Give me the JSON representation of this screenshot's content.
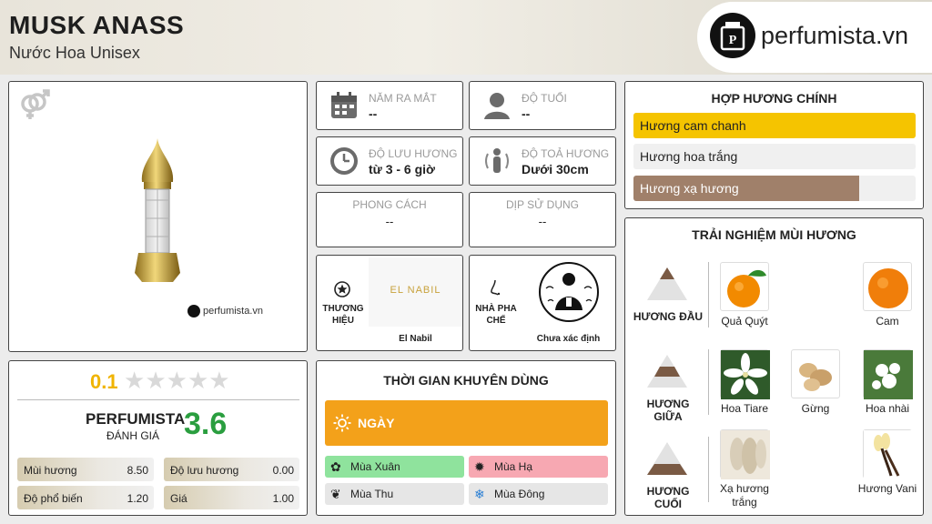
{
  "header": {
    "title": "MUSK ANASS",
    "subtitle": "Nước Hoa Unisex",
    "brand": "perfumista.vn"
  },
  "product": {
    "gender_icon": "gender-unisex-icon",
    "watermark": "perfumista.vn"
  },
  "info": {
    "release_label": "NĂM RA MẮT",
    "release_value": "--",
    "age_label": "ĐỘ TUỔI",
    "age_value": "--",
    "longevity_label": "ĐỘ LƯU HƯƠNG",
    "longevity_value": "từ 3 - 6 giờ",
    "sillage_label": "ĐỘ TOẢ HƯƠNG",
    "sillage_value": "Dưới 30cm",
    "style_label": "PHONG CÁCH",
    "style_value": "--",
    "occasion_label": "DỊP SỬ DỤNG",
    "occasion_value": "--",
    "brand_label": "THƯƠNG HIỆU",
    "brand_logo": "EL NABIL",
    "brand_value": "El Nabil",
    "perfumer_label": "NHÀ PHA CHẾ",
    "perfumer_value": "Chưa xác định"
  },
  "rating": {
    "user_score": "0.1",
    "stars_total": 5,
    "perfumista_label": "PERFUMISTA",
    "perfumista_sub": "ĐÁNH GIÁ",
    "perfumista_score": "3.6",
    "stats": [
      {
        "label": "Mùi hương",
        "value": "8.50"
      },
      {
        "label": "Độ lưu hương",
        "value": "0.00"
      },
      {
        "label": "Độ phổ biến",
        "value": "1.20"
      },
      {
        "label": "Giá",
        "value": "1.00"
      }
    ]
  },
  "time": {
    "title": "THỜI GIAN KHUYÊN DÙNG",
    "day_label": "NGÀY",
    "seasons": [
      {
        "label": "Mùa Xuân",
        "color": "#8fe39d"
      },
      {
        "label": "Mùa Hạ",
        "color": "#f7a8b2"
      },
      {
        "label": "Mùa Thu",
        "color": "#e6e6e6"
      },
      {
        "label": "Mùa Đông",
        "color": "#e6e6e6"
      }
    ]
  },
  "accords": {
    "title": "HỢP HƯƠNG CHÍNH",
    "items": [
      {
        "label": "Hương cam chanh",
        "level": 1.0,
        "color": "#f5c400"
      },
      {
        "label": "Hương hoa trắng",
        "level": 0.0,
        "color": "#ffffff"
      },
      {
        "label": "Hương xạ hương",
        "level": 0.8,
        "color": "#a0806a"
      }
    ]
  },
  "notes": {
    "title": "TRẢI NGHIỆM MÙI HƯƠNG",
    "top_label": "HƯƠNG ĐẦU",
    "middle_label": "HƯƠNG GIỮA",
    "base_label": "HƯƠNG CUỐI",
    "top": [
      "Quả Quýt",
      "Cam"
    ],
    "middle": [
      "Hoa Tiare",
      "Gừng",
      "Hoa nhài"
    ],
    "base": [
      "Xạ hương trắng",
      "Hương Vani"
    ]
  }
}
